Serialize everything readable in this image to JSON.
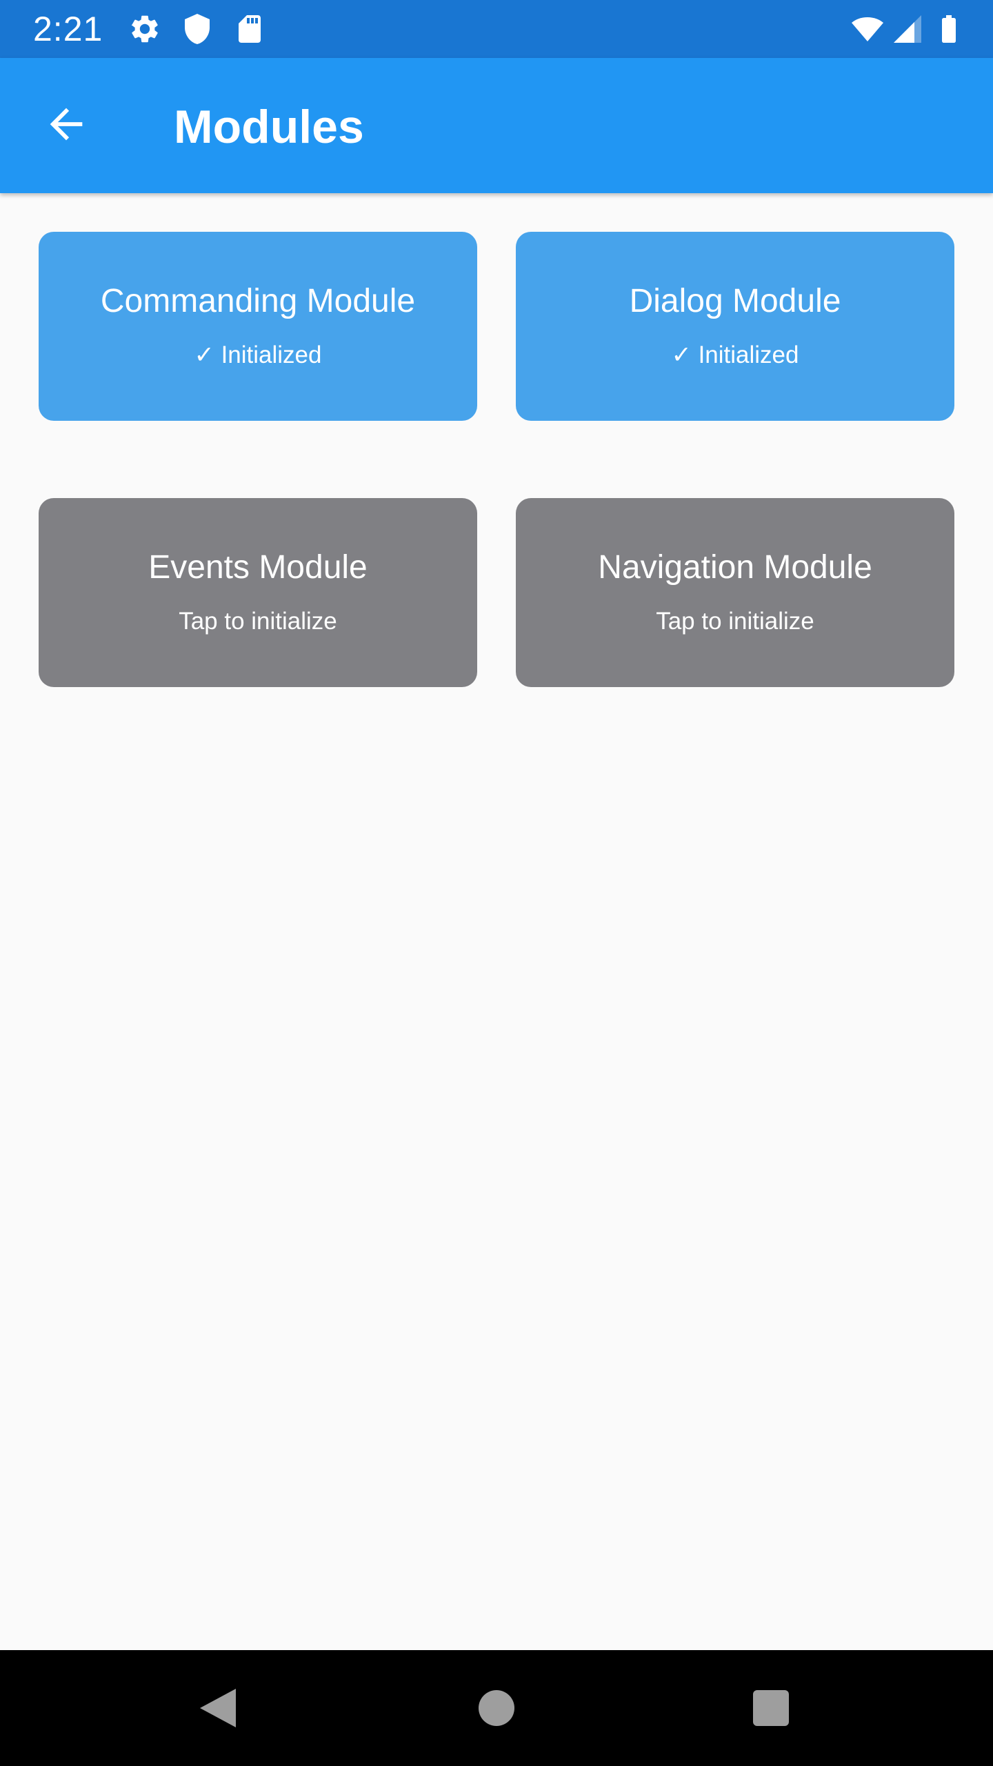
{
  "status_bar": {
    "time": "2:21",
    "left_icons": [
      "gear-icon",
      "shield-icon",
      "sd-card-icon"
    ],
    "right_icons": [
      "wifi-icon",
      "cell-signal-icon",
      "battery-icon"
    ]
  },
  "app_bar": {
    "back_icon": "arrow-back-icon",
    "title": "Modules"
  },
  "modules": [
    {
      "name": "Commanding Module",
      "status": "✓ Initialized",
      "initialized": true
    },
    {
      "name": "Dialog Module",
      "status": "✓ Initialized",
      "initialized": true
    },
    {
      "name": "Events Module",
      "status": "Tap to initialize",
      "initialized": false
    },
    {
      "name": "Navigation Module",
      "status": "Tap to initialize",
      "initialized": false
    }
  ],
  "nav_bar": {
    "buttons": [
      "back-triangle-icon",
      "home-circle-icon",
      "recents-square-icon"
    ]
  },
  "colors": {
    "status_bar": "#1976D2",
    "app_bar": "#2196F3",
    "initialized_tile": "#47A3EB",
    "uninitialized_tile": "#808084",
    "background": "#FAFAFA"
  }
}
